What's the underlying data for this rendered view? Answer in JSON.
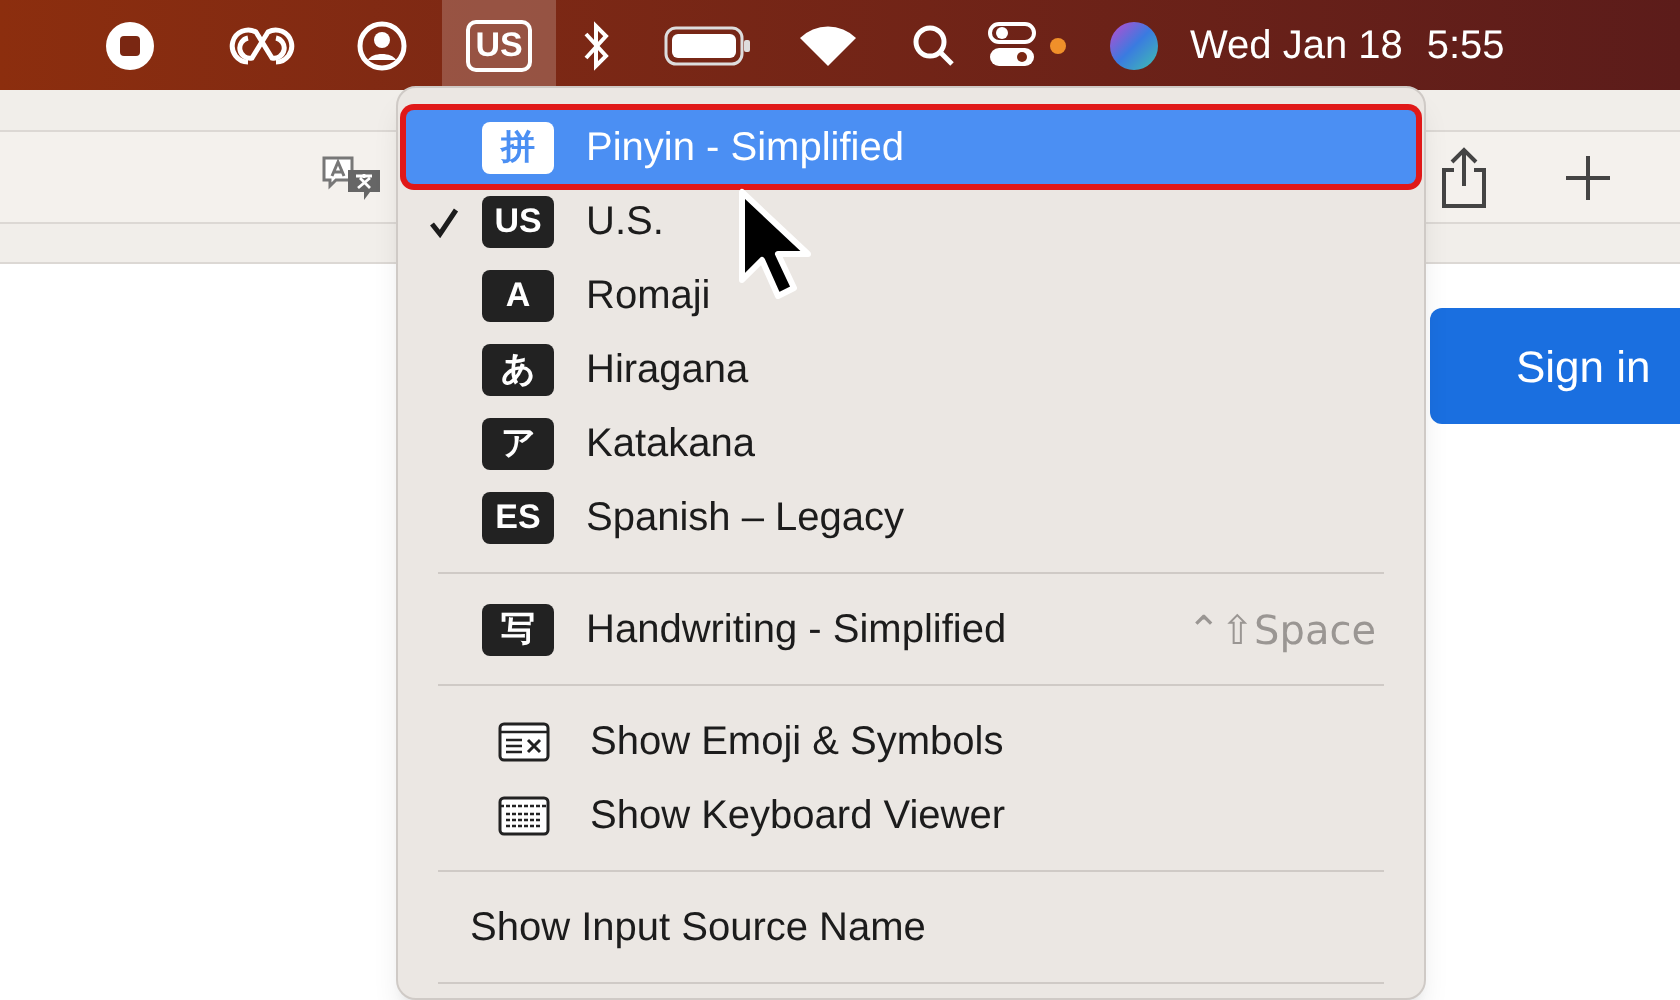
{
  "menu_bar": {
    "input_badge": "US",
    "input_open": true,
    "date": "Wed Jan 18",
    "time": "5:55"
  },
  "browser": {
    "sign_in": "Sign in"
  },
  "menu": {
    "items": [
      {
        "kind": "source",
        "badge": "拼",
        "label": "Pinyin - Simplified",
        "selected": true,
        "checked": false,
        "annotated": true
      },
      {
        "kind": "source",
        "badge": "US",
        "label": "U.S.",
        "selected": false,
        "checked": true,
        "annotated": false
      },
      {
        "kind": "source",
        "badge": "A",
        "label": "Romaji",
        "selected": false,
        "checked": false,
        "annotated": false
      },
      {
        "kind": "source",
        "badge": "あ",
        "label": "Hiragana",
        "selected": false,
        "checked": false,
        "annotated": false
      },
      {
        "kind": "source",
        "badge": "ア",
        "label": "Katakana",
        "selected": false,
        "checked": false,
        "annotated": false
      },
      {
        "kind": "source",
        "badge": "ES",
        "label": "Spanish – Legacy",
        "selected": false,
        "checked": false,
        "annotated": false
      },
      {
        "kind": "separator"
      },
      {
        "kind": "source",
        "badge": "写",
        "label": "Handwriting - Simplified",
        "shortcut": "⌃⇧Space",
        "selected": false,
        "checked": false,
        "annotated": false
      },
      {
        "kind": "separator"
      },
      {
        "kind": "emoji",
        "label": "Show Emoji & Symbols"
      },
      {
        "kind": "keyboard",
        "label": "Show Keyboard Viewer"
      },
      {
        "kind": "separator"
      },
      {
        "kind": "plain",
        "label": "Show Input Source Name"
      },
      {
        "kind": "separator"
      }
    ]
  }
}
